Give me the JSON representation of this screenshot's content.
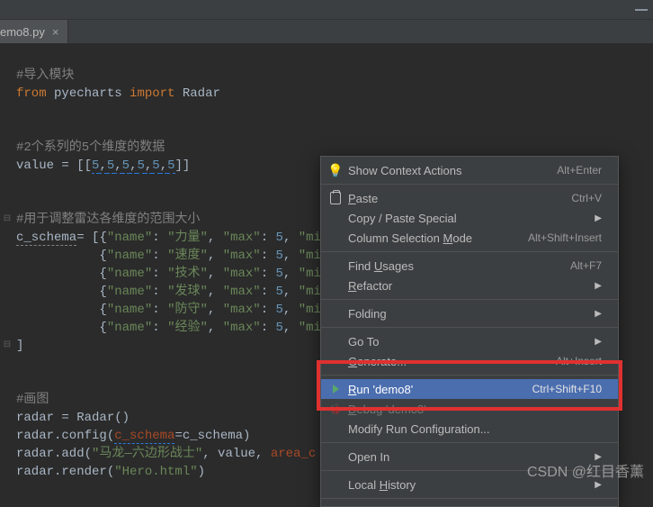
{
  "tab": {
    "filename": "emo8.py",
    "close": "×"
  },
  "code": {
    "c1": "#导入模块",
    "kw_from": "from",
    "mod": "pyecharts",
    "kw_import": "import",
    "cls": "Radar",
    "c2": "#2个系列的5个维度的数据",
    "val_lhs": "value",
    "eq": " = ",
    "lbr": "[[",
    "n5": "5",
    "comma": ",",
    "rbr": "]]",
    "c3": "#用于调整雷达各维度的范围大小",
    "schema_lhs": "c_schema",
    "assign": "= ",
    "lb": "[",
    "lbrace": "{",
    "rbrace": "}",
    "k_name": "\"name\"",
    "colon": ": ",
    "k_max": "\"max\"",
    "k_mi": "\"mi",
    "names": [
      "\"力量\"",
      "\"速度\"",
      "\"技术\"",
      "\"发球\"",
      "\"防守\"",
      "\"经验\""
    ],
    "close_sq": "]",
    "c4": "#画图",
    "r1_a": "radar",
    "r1_b": " = Radar()",
    "r2_a": "radar.config(",
    "r2_b": "c_schema",
    "r2_c": "=c_schema)",
    "r3_a": "radar.add(",
    "r3_b": "\"马龙—六边形战士\"",
    "r3_c": ", value, ",
    "r3_d": "area_c",
    "r4_a": "radar.render(",
    "r4_b": "\"Hero.html\"",
    "r4_c": ")"
  },
  "menu": {
    "items": [
      {
        "label": "Show Context Actions",
        "shortcut": "Alt+Enter",
        "icon": "bulb",
        "u": -1
      },
      {
        "sep": true
      },
      {
        "label": "Paste",
        "shortcut": "Ctrl+V",
        "icon": "paste",
        "u": 0
      },
      {
        "label": "Copy / Paste Special",
        "arrow": true,
        "u": -1
      },
      {
        "label": "Column Selection Mode",
        "shortcut": "Alt+Shift+Insert",
        "u": 17
      },
      {
        "sep": true
      },
      {
        "label": "Find Usages",
        "shortcut": "Alt+F7",
        "u": 5
      },
      {
        "label": "Refactor",
        "arrow": true,
        "u": 0
      },
      {
        "sep": true
      },
      {
        "label": "Folding",
        "arrow": true,
        "u": -1
      },
      {
        "sep": true
      },
      {
        "label": "Go To",
        "arrow": true,
        "u": -1
      },
      {
        "label": "Generate...",
        "shortcut": "Alt+Insert",
        "u": 0
      },
      {
        "sep": true
      },
      {
        "label": "Run 'demo8'",
        "shortcut": "Ctrl+Shift+F10",
        "icon": "run",
        "u": 0,
        "sel": true
      },
      {
        "label": "Debug 'demo8'",
        "icon": "debug",
        "u": 0,
        "dim": true
      },
      {
        "label": "Modify Run Configuration...",
        "u": -1
      },
      {
        "sep": true
      },
      {
        "label": "Open In",
        "arrow": true,
        "u": -1
      },
      {
        "sep": true
      },
      {
        "label": "Local History",
        "arrow": true,
        "u": 6
      },
      {
        "sep": true
      }
    ]
  },
  "watermark": "CSDN @红目香薰"
}
